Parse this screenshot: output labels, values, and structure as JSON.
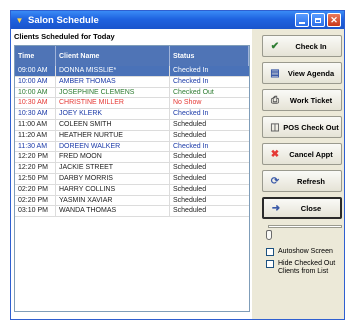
{
  "window": {
    "title": "Salon Schedule",
    "icon": "app-icon",
    "accent": "#1f63e0",
    "close_color": "#c8381a"
  },
  "schedule": {
    "heading": "Clients Scheduled for Today",
    "columns": {
      "time": "Time",
      "name": "Client Name",
      "status": "Status"
    },
    "selected_row": 0,
    "rows": [
      {
        "time": "09:00 AM",
        "name": "DONNA MISSLIE*",
        "status": "Checked In",
        "color": "#1b3aa8"
      },
      {
        "time": "10:00 AM",
        "name": "AMBER THOMAS",
        "status": "Checked In",
        "color": "#1b3aa8"
      },
      {
        "time": "10:00 AM",
        "name": "JOSEPHINE CLEMENS",
        "status": "Checked Out",
        "color": "#2e7d32"
      },
      {
        "time": "10:30 AM",
        "name": "CHRISTINE MILLER",
        "status": "No Show",
        "color": "#e53935"
      },
      {
        "time": "10:30 AM",
        "name": "JOEY KLERK",
        "status": "Checked In",
        "color": "#1b3aa8"
      },
      {
        "time": "11:00 AM",
        "name": "COLEEN SMITH",
        "status": "Scheduled",
        "color": "#222222"
      },
      {
        "time": "11:20 AM",
        "name": "HEATHER NURTUE",
        "status": "Scheduled",
        "color": "#222222"
      },
      {
        "time": "11:30 AM",
        "name": "DOREEN WALKER",
        "status": "Checked In",
        "color": "#1b3aa8"
      },
      {
        "time": "12:20 PM",
        "name": "FRED MOON",
        "status": "Scheduled",
        "color": "#222222"
      },
      {
        "time": "12:20 PM",
        "name": "JACKIE STREET",
        "status": "Scheduled",
        "color": "#222222"
      },
      {
        "time": "12:50 PM",
        "name": "DARBY MORRIS",
        "status": "Scheduled",
        "color": "#222222"
      },
      {
        "time": "02:20 PM",
        "name": "HARRY COLLINS",
        "status": "Scheduled",
        "color": "#222222"
      },
      {
        "time": "02:20 PM",
        "name": "YASMIN XAVIAR",
        "status": "Scheduled",
        "color": "#222222"
      },
      {
        "time": "03:10 PM",
        "name": "WANDA THOMAS",
        "status": "Scheduled",
        "color": "#222222"
      }
    ]
  },
  "actions": {
    "check_in": {
      "label": "Check In",
      "icon": "checkmark-icon"
    },
    "view_agenda": {
      "label": "View Agenda",
      "icon": "agenda-icon"
    },
    "work_ticket": {
      "label": "Work Ticket",
      "icon": "printer-icon"
    },
    "pos_check_out": {
      "label": "POS Check Out",
      "icon": "cart-icon"
    },
    "cancel_appt": {
      "label": "Cancel Appt",
      "icon": "x-mark-icon"
    },
    "refresh": {
      "label": "Refresh",
      "icon": "refresh-icon"
    },
    "close": {
      "label": "Close",
      "icon": "exit-icon"
    }
  },
  "options": {
    "slider_value": 0,
    "autoshow_label": "Autoshow Screen",
    "hide_checked_out_label": "Hide Checked Out Clients from List"
  }
}
